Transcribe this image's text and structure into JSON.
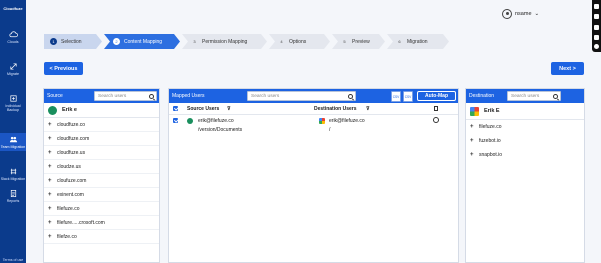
{
  "brand": {
    "name": "Cloudfuze"
  },
  "sidebar": {
    "items": [
      {
        "label": "Clouds",
        "icon": "cloud-icon"
      },
      {
        "label": "Migrate",
        "icon": "migrate-icon"
      },
      {
        "label": "Individual Backup",
        "icon": "backup-icon"
      },
      {
        "label": "Team Migration",
        "icon": "team-icon"
      },
      {
        "label": "Slack Migration",
        "icon": "slack-icon"
      },
      {
        "label": "Reports",
        "icon": "reports-icon"
      }
    ],
    "terms": "Terms of use"
  },
  "header": {
    "user_name": "nsame"
  },
  "steps": [
    {
      "num": "1",
      "label": "Selection",
      "state": "done"
    },
    {
      "num": "2",
      "label": "Content Mapping",
      "state": "current"
    },
    {
      "num": "3",
      "label": "Permission Mapping",
      "state": "todo"
    },
    {
      "num": "4",
      "label": "Options",
      "state": "todo"
    },
    {
      "num": "5",
      "label": "Preview",
      "state": "todo"
    },
    {
      "num": "6",
      "label": "Migration",
      "state": "todo"
    }
  ],
  "nav": {
    "previous": "< Previous",
    "next": "Next >"
  },
  "source": {
    "title": "Source",
    "search_placeholder": "Search users",
    "owner": "Erik e",
    "items": [
      "cloudfuze.co",
      "cloudfuze.com",
      "cloudfuze.us",
      "cloudze.us",
      "cloufuze.com",
      "exinent.com",
      "filefuze.co",
      "filefure.....crosoft.com",
      "filefze.co"
    ]
  },
  "mapped": {
    "title": "Mapped Users",
    "search_placeholder": "Search users",
    "csv_label": "CSV",
    "auto_map": "Auto-Map",
    "col_source": "Source Users",
    "col_destination": "Destination Users",
    "rows": [
      {
        "source_email": "erik@filefuze.co",
        "source_path": "/version/Documents",
        "dest_email": "erik@filefuze.co",
        "dest_path": "/"
      }
    ]
  },
  "destination": {
    "title": "Destination",
    "search_placeholder": "Search users",
    "owner": "Erik E",
    "items": [
      "filefuze.co",
      "fuzebot.io",
      "snapbot.io"
    ]
  },
  "colors": {
    "sidebar": "#0b3b8c",
    "accent": "#1d63e2",
    "step_done": "#c9d6ee"
  }
}
